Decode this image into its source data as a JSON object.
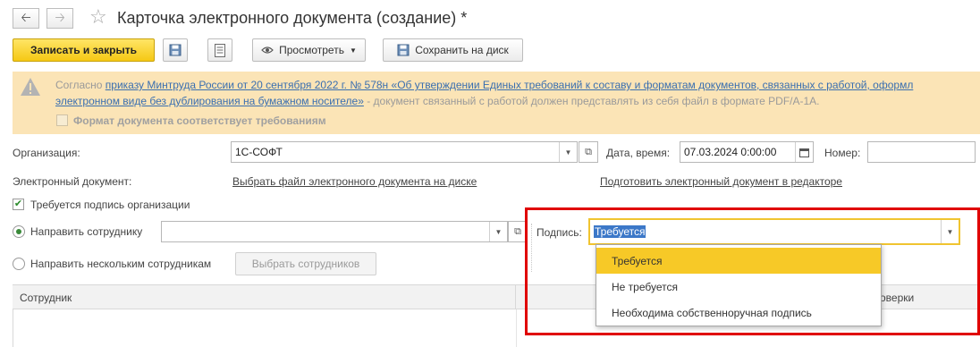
{
  "window": {
    "title": "Карточка электронного документа (создание) *",
    "nav_back_icon": "arrow-left-icon",
    "nav_forward_icon": "arrow-right-icon",
    "favorite_icon": "star-icon"
  },
  "toolbar": {
    "save_close_label": "Записать и закрыть",
    "preview_label": "Просмотреть",
    "save_to_disk_label": "Сохранить на диск"
  },
  "warning": {
    "prefix": "Согласно ",
    "link": "приказу Минтруда России от 20 сентября 2022 г. № 578н «Об утверждении Единых требований к составу и форматам документов, связанных с работой, оформл",
    "line2_link": "электронном виде без дублирования на бумажном носителе»",
    "line2_rest": " - документ связанный с работой должен представлять из себя файл в формате PDF/A-1A.",
    "checkbox_label": "Формат документа соответствует требованиям"
  },
  "form": {
    "org_label": "Организация:",
    "org_value": "1С-СОФТ",
    "datetime_label": "Дата, время:",
    "datetime_value": "07.03.2024  0:00:00",
    "number_label": "Номер:",
    "number_value": "",
    "edoc_label": "Электронный документ:",
    "choose_file_link": "Выбрать файл электронного документа на диске",
    "prepare_editor_link": "Подготовить электронный документ в редакторе",
    "requires_sign_label": "Требуется подпись организации",
    "send_employee_label": "Направить сотруднику",
    "send_employee_value": "",
    "send_many_label": "Направить нескольким сотрудникам",
    "choose_employees_label": "Выбрать сотрудников",
    "sign_label": "Подпись:",
    "sign_value": "Требуется"
  },
  "table": {
    "col_employee": "Сотрудник",
    "col_partial": "оверки"
  },
  "dropdown": {
    "options": [
      "Требуется",
      "Не требуется",
      "Необходима собственноручная подпись"
    ],
    "selected": "Требуется"
  },
  "colors": {
    "primary_button": "#f5c814",
    "warning_bg": "#fbe4b6",
    "highlight_frame": "#e00000",
    "link": "#3a6fb0"
  }
}
